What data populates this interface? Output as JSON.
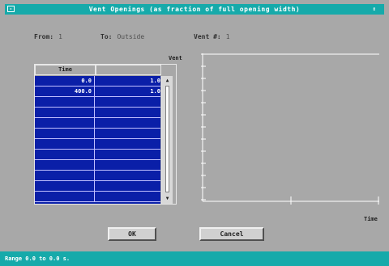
{
  "window": {
    "title": "Vent Openings (as fraction of full opening width)",
    "sysmenu_icon": "system-menu-icon",
    "control_icon": "window-controls-icon"
  },
  "info": {
    "from_label": "From:",
    "from_value": "1",
    "to_label": "To:",
    "to_value": "Outside",
    "vent_label": "Vent #:",
    "vent_value": "1"
  },
  "table": {
    "columns": [
      "Time",
      ""
    ],
    "rows": [
      [
        "0.0",
        "1.0"
      ],
      [
        "400.0",
        "1.0"
      ],
      [
        "",
        ""
      ],
      [
        "",
        ""
      ],
      [
        "",
        ""
      ],
      [
        "",
        ""
      ],
      [
        "",
        ""
      ],
      [
        "",
        ""
      ],
      [
        "",
        ""
      ],
      [
        "",
        ""
      ],
      [
        "",
        ""
      ],
      [
        "",
        ""
      ]
    ],
    "row_color": "#0a1fa8"
  },
  "chart_data": {
    "type": "line",
    "ylabel": "Vent",
    "xlabel": "Time",
    "series": [],
    "grid": false
  },
  "buttons": {
    "ok": "OK",
    "cancel": "Cancel"
  },
  "status": {
    "text": "Range 0.0 to 0.0 s."
  },
  "colors": {
    "titlebar": "#16aaaa",
    "background": "#a8a8a8"
  }
}
